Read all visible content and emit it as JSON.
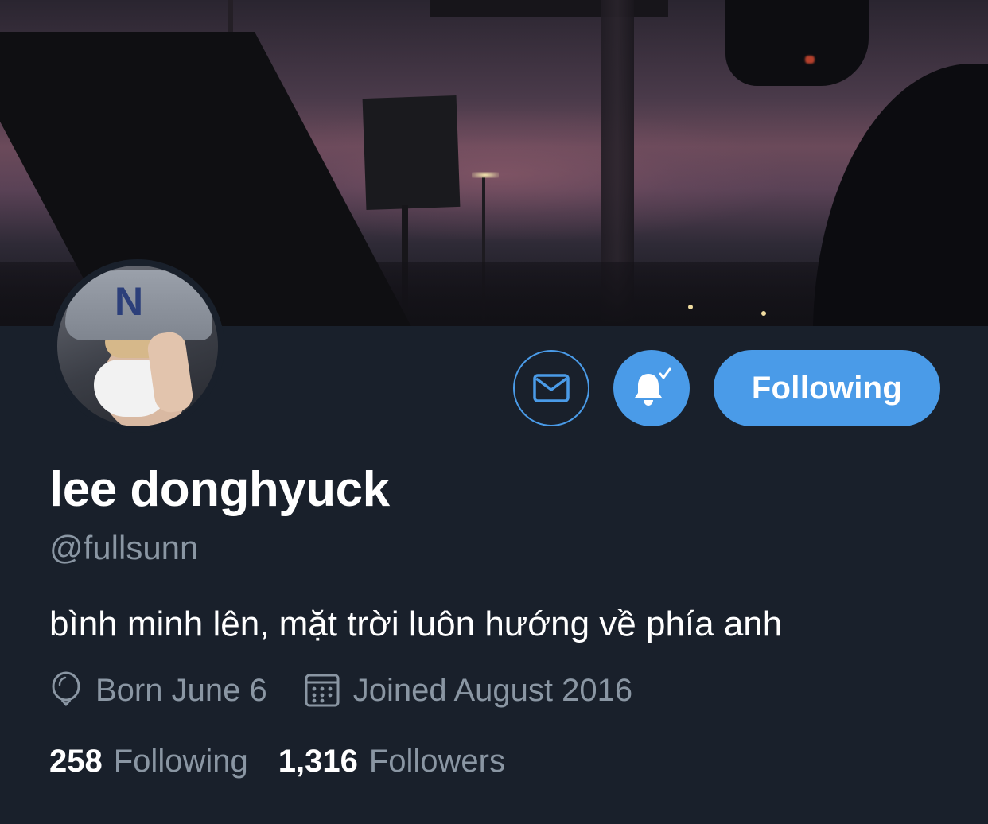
{
  "profile": {
    "display_name": "lee donghyuck",
    "handle": "@fullsunn",
    "bio": "bình minh lên, mặt trời luôn hướng về phía anh",
    "birthday": "Born June 6",
    "joined": "Joined August 2016"
  },
  "actions": {
    "message_icon": "envelope-icon",
    "notify_icon": "bell-check-icon",
    "follow_label": "Following"
  },
  "stats": {
    "following_count": "258",
    "following_label": "Following",
    "followers_count": "1,316",
    "followers_label": "Followers"
  },
  "icons": {
    "birthday": "balloon-icon",
    "joined": "calendar-icon"
  },
  "colors": {
    "accent": "#4a9be8",
    "background": "#19202b",
    "secondary_text": "#8a96a3",
    "primary_text": "#ffffff"
  }
}
